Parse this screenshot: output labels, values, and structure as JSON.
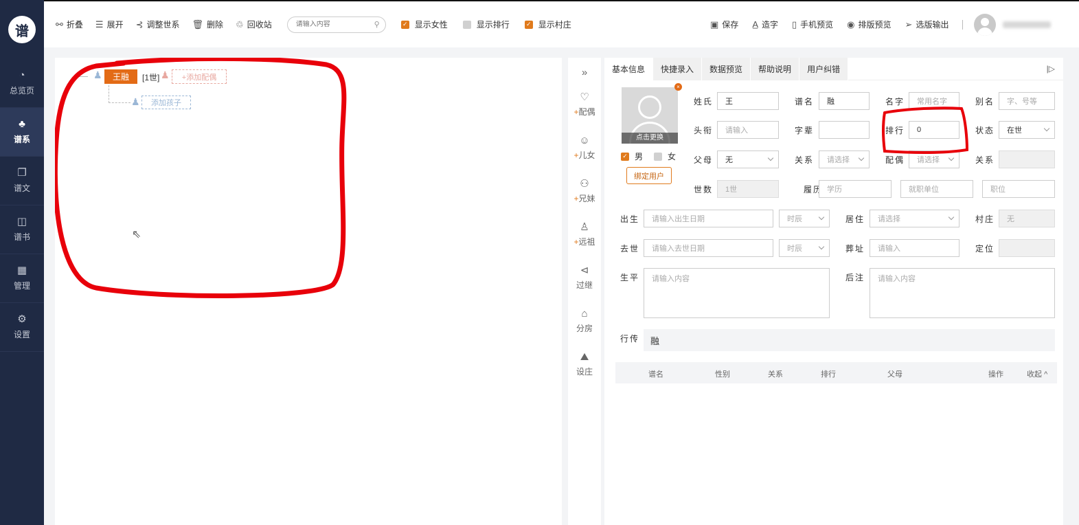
{
  "logo": {
    "text": "谱"
  },
  "sidebar": {
    "items": [
      {
        "label": "总览页",
        "icon": "pie-chart-icon",
        "glyph": "◔"
      },
      {
        "label": "谱系",
        "icon": "family-tree-icon",
        "glyph": "♣"
      },
      {
        "label": "谱文",
        "icon": "document-icon",
        "glyph": "❐"
      },
      {
        "label": "谱书",
        "icon": "book-icon",
        "glyph": "◫"
      },
      {
        "label": "管理",
        "icon": "grid-icon",
        "glyph": "▦"
      },
      {
        "label": "设置",
        "icon": "gear-icon",
        "glyph": "⚙"
      }
    ]
  },
  "toolbar": {
    "collapse": "折叠",
    "expand": "展开",
    "adjust": "调整世系",
    "delete": "删除",
    "recycle": "回收站",
    "search_placeholder": "请输入内容",
    "show_female": "显示女性",
    "show_rank": "显示排行",
    "show_village": "显示村庄",
    "save": "保存",
    "create_char": "造字",
    "mobile_preview": "手机预览",
    "layout_preview": "排版预览",
    "export": "选版输出"
  },
  "tree": {
    "root_name": "王融",
    "root_gen": "[1世]",
    "add_spouse": "+添加配偶",
    "add_child": "添加孩子"
  },
  "tools": [
    {
      "label": "配偶",
      "plus": "+",
      "icon": "spouse-icon",
      "glyph": "♡"
    },
    {
      "label": "儿女",
      "plus": "+",
      "icon": "child-icon",
      "glyph": "☺"
    },
    {
      "label": "兄妹",
      "plus": "+",
      "icon": "siblings-icon",
      "glyph": "⚇"
    },
    {
      "label": "远祖",
      "plus": "+",
      "icon": "ancestor-icon",
      "glyph": "♙"
    },
    {
      "label": "过继",
      "plus": "",
      "icon": "share-icon",
      "glyph": "⊲"
    },
    {
      "label": "分房",
      "plus": "",
      "icon": "house-icon",
      "glyph": "⌂"
    },
    {
      "label": "设庄",
      "plus": "",
      "icon": "landscape-icon",
      "glyph": "⛰"
    }
  ],
  "tabs": [
    "基本信息",
    "快捷录入",
    "数据预览",
    "帮助说明",
    "用户纠错"
  ],
  "form": {
    "photo_caption": "点击更换",
    "male": "男",
    "female": "女",
    "bind_user": "绑定用户",
    "surname_label": "姓氏",
    "surname": "王",
    "pu_name_label": "谱名",
    "pu_name": "融",
    "name_label": "名字",
    "name_placeholder": "常用名字",
    "alias_label": "别名",
    "alias_placeholder": "字、号等",
    "title_label": "头衔",
    "title_placeholder": "请输入",
    "zibei_label": "字辈",
    "zibei": "",
    "rank_label": "排行",
    "rank": "0",
    "status_label": "状态",
    "status": "在世",
    "parent_label": "父母",
    "parent": "无",
    "relation_label": "关系",
    "relation_placeholder": "请选择",
    "spouse_label": "配偶",
    "spouse_placeholder": "请选择",
    "relation2_label": "关系",
    "gen_label": "世数",
    "gen": "1世",
    "resume_label": "履历",
    "edu_placeholder": "学历",
    "work_placeholder": "就职单位",
    "post_placeholder": "职位",
    "birth_label": "出生",
    "birth_placeholder": "请输入出生日期",
    "shichen_placeholder": "时辰",
    "residence_label": "居住",
    "residence_placeholder": "请选择",
    "village_label": "村庄",
    "village": "无",
    "death_label": "去世",
    "death_placeholder": "请输入去世日期",
    "shichen2_placeholder": "时辰",
    "burial_label": "葬址",
    "burial_placeholder": "请输入",
    "locate_label": "定位",
    "life_label": "生平",
    "life_placeholder": "请输入内容",
    "after_label": "后注",
    "after_placeholder": "请输入内容",
    "bio_label": "行传",
    "bio": "融"
  },
  "table": {
    "headers": [
      "谱名",
      "性别",
      "关系",
      "排行",
      "父母",
      "操作"
    ],
    "collapse": "收起"
  },
  "colors": {
    "accent": "#e36b16",
    "sidebar": "#1f2a44",
    "annotation": "#e8000a"
  }
}
